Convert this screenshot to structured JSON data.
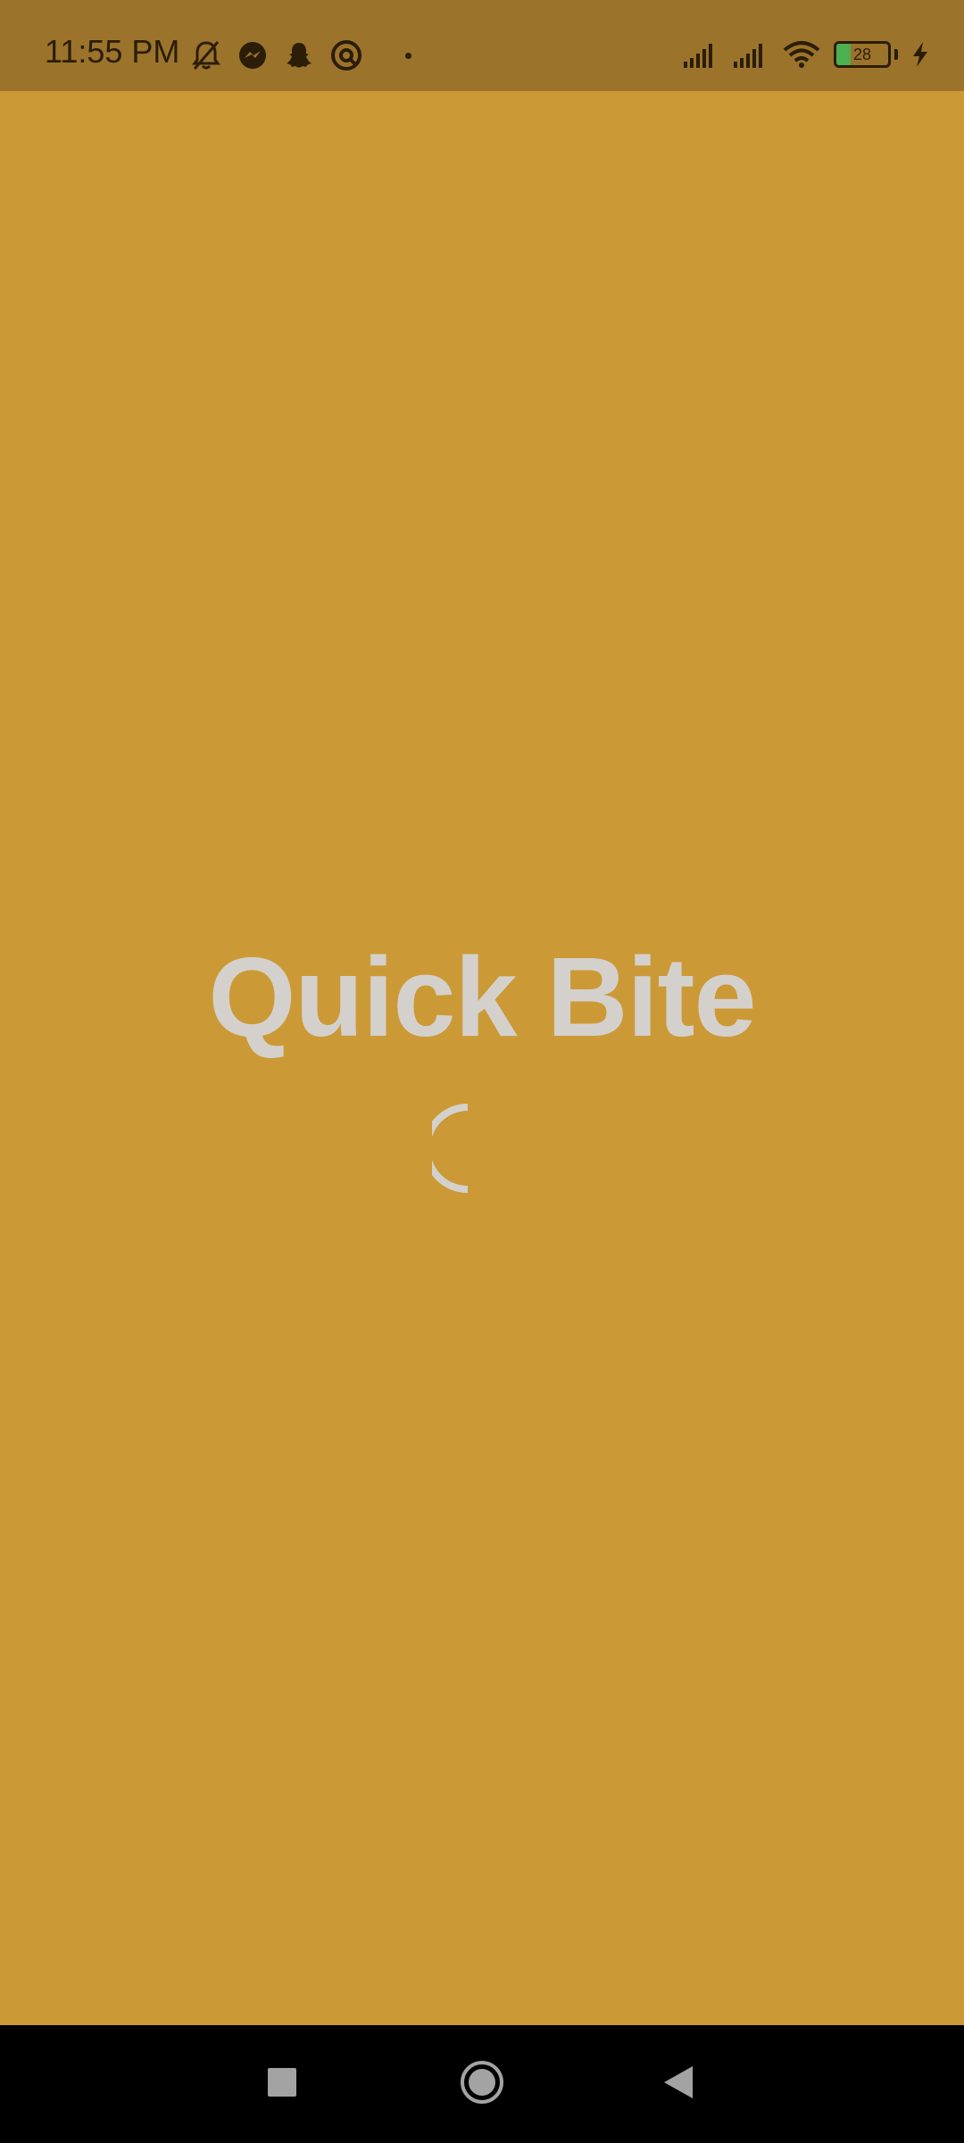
{
  "status_bar": {
    "time": "11:55 PM",
    "left_icons": [
      "bell-off-icon",
      "messenger-icon",
      "snapchat-icon",
      "app-circle-icon",
      "dot-icon"
    ],
    "right_icons": [
      "signal-1-icon",
      "signal-2-icon",
      "wifi-icon",
      "battery-icon",
      "charging-icon"
    ],
    "battery_level": "28",
    "battery_fraction": 0.28,
    "battery_fill_color": "#4caf50"
  },
  "splash": {
    "title": "Quick Bite",
    "loading_indicator": "spinner-icon"
  },
  "colors": {
    "background": "#cb9a36",
    "status_bar": "#9b732a",
    "title_text": "#d4d1cd",
    "nav_bar": "#000000"
  },
  "nav_bar": {
    "buttons": [
      "recent-apps-icon",
      "home-icon",
      "back-icon"
    ]
  }
}
